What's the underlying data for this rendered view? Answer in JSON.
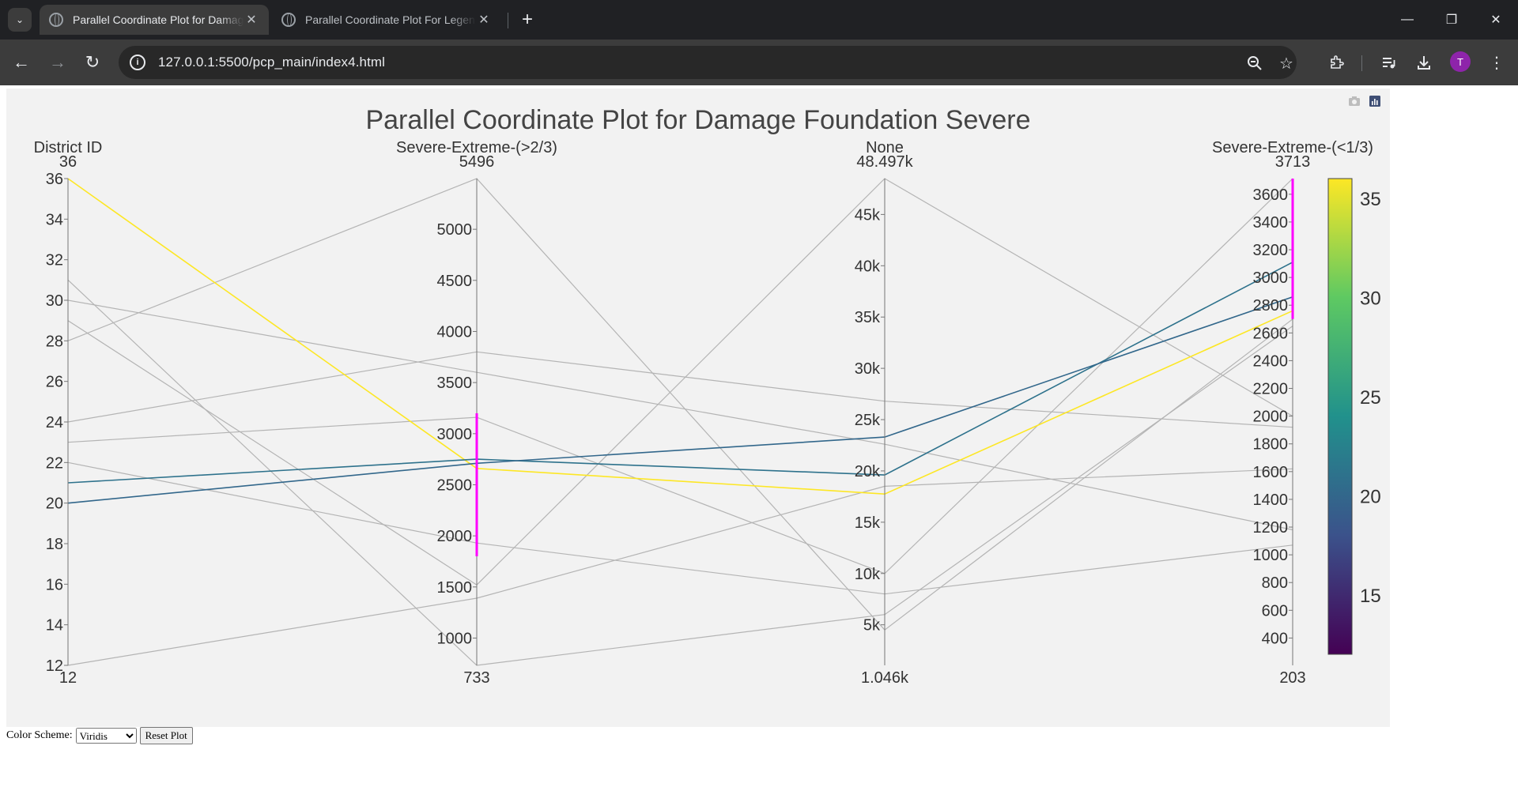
{
  "browser": {
    "tabs": [
      {
        "title": "Parallel Coordinate Plot for Damage Foundation Severe",
        "close": "✕"
      },
      {
        "title": "Parallel Coordinate Plot For Legends",
        "close": "✕"
      }
    ],
    "new_tab": "+",
    "url": "127.0.0.1:5500/pcp_main/index4.html",
    "profile_initial": "T",
    "window": {
      "minimize": "—",
      "restore": "❐",
      "close": "✕"
    }
  },
  "colors": {
    "accent_brush": "#ff00ff",
    "line_unselected": "#b4b4b4",
    "plot_bg": "#f2f2f2",
    "chrome_dark": "#202124",
    "chrome_toolbar": "#3c3c3c",
    "viridis": [
      "#440154",
      "#3b528b",
      "#21918c",
      "#5ec962",
      "#fde725"
    ]
  },
  "controls": {
    "color_scheme_label": "Color Scheme:",
    "color_scheme_value": "Viridis",
    "color_scheme_options": [
      "Viridis"
    ],
    "reset_label": "Reset Plot"
  },
  "chart_data": {
    "type": "parallel-coordinates",
    "title": "Parallel Coordinate Plot for Damage Foundation Severe",
    "dimensions": [
      {
        "label": "District ID",
        "range": [
          12,
          36
        ],
        "min_label": "12",
        "max_label": "36",
        "ticks": [
          12,
          14,
          16,
          18,
          20,
          22,
          24,
          26,
          28,
          30,
          32,
          34,
          36
        ],
        "tick_labels": [
          "12",
          "14",
          "16",
          "18",
          "20",
          "22",
          "24",
          "26",
          "28",
          "30",
          "32",
          "34",
          "36"
        ]
      },
      {
        "label": "Severe-Extreme-(>2/3)",
        "range": [
          733,
          5496
        ],
        "min_label": "733",
        "max_label": "5496",
        "ticks": [
          1000,
          1500,
          2000,
          2500,
          3000,
          3500,
          4000,
          4500,
          5000
        ],
        "tick_labels": [
          "1000",
          "1500",
          "2000",
          "2500",
          "3000",
          "3500",
          "4000",
          "4500",
          "5000"
        ],
        "constraint": [
          1800,
          3200
        ]
      },
      {
        "label": "None",
        "range": [
          1046,
          48497
        ],
        "min_label": "1.046k",
        "max_label": "48.497k",
        "ticks": [
          5000,
          10000,
          15000,
          20000,
          25000,
          30000,
          35000,
          40000,
          45000
        ],
        "tick_labels": [
          "5k",
          "10k",
          "15k",
          "20k",
          "25k",
          "30k",
          "35k",
          "40k",
          "45k"
        ]
      },
      {
        "label": "Severe-Extreme-(<1/3)",
        "range": [
          203,
          3713
        ],
        "min_label": "203",
        "max_label": "3713",
        "ticks": [
          400,
          600,
          800,
          1000,
          1200,
          1400,
          1600,
          1800,
          2000,
          2200,
          2400,
          2600,
          2800,
          3000,
          3200,
          3400,
          3600
        ],
        "tick_labels": [
          "400",
          "600",
          "800",
          "1000",
          "1200",
          "1400",
          "1600",
          "1800",
          "2000",
          "2200",
          "2400",
          "2600",
          "2800",
          "3000",
          "3200",
          "3400",
          "3600"
        ],
        "constraint": [
          2700,
          3713
        ]
      }
    ],
    "lines": [
      {
        "district": 36,
        "values": [
          36,
          2660,
          17750,
          2760
        ],
        "selected": true
      },
      {
        "district": 21,
        "values": [
          21,
          2750,
          19600,
          3110
        ],
        "selected": true
      },
      {
        "district": 20,
        "values": [
          20,
          2710,
          23300,
          2860
        ],
        "selected": true
      },
      {
        "district": 12,
        "values": [
          12,
          1390,
          18500,
          1620
        ],
        "selected": false
      },
      {
        "district": 22,
        "values": [
          22,
          1930,
          8000,
          1070
        ],
        "selected": false
      },
      {
        "district": 23,
        "values": [
          23,
          3160,
          10000,
          3713
        ],
        "selected": false
      },
      {
        "district": 24,
        "values": [
          24,
          3800,
          26800,
          1920
        ],
        "selected": false
      },
      {
        "district": 28,
        "values": [
          28,
          5496,
          4500,
          2700
        ],
        "selected": false
      },
      {
        "district": 29,
        "values": [
          29,
          1520,
          48497,
          2000
        ],
        "selected": false
      },
      {
        "district": 30,
        "values": [
          30,
          3600,
          22600,
          1180
        ],
        "selected": false
      },
      {
        "district": 31,
        "values": [
          31,
          733,
          6000,
          2650
        ],
        "selected": false
      }
    ],
    "colorbar": {
      "range": [
        12,
        36
      ],
      "ticks": [
        15,
        20,
        25,
        30,
        35
      ],
      "tick_labels": [
        "15",
        "20",
        "25",
        "30",
        "35"
      ],
      "colorscale": "Viridis"
    }
  }
}
